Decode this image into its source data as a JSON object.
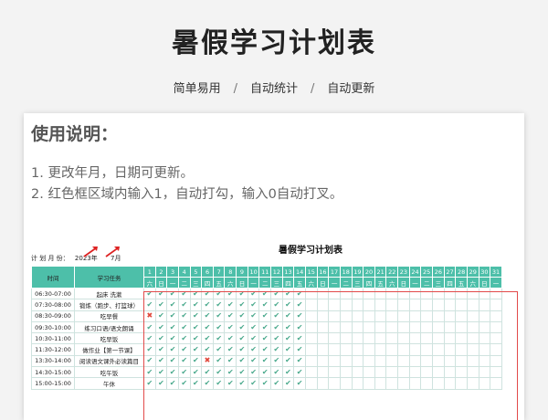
{
  "header": {
    "title": "暑假学习计划表",
    "tags": [
      "简单易用",
      "自动统计",
      "自动更新"
    ],
    "separator": "/"
  },
  "usage": {
    "heading": "使用说明：",
    "lines": [
      "1. 更改年月，日期可更新。",
      "2. 红色框区域内输入1，自动打勾，输入0自动打叉。"
    ]
  },
  "sheet": {
    "title": "暑假学习计划表",
    "plan_label": "计 划 月 份：",
    "year": "2023年",
    "month": "7月",
    "col_time": "时间",
    "col_task": "学习任务",
    "days": [
      "1",
      "2",
      "3",
      "4",
      "5",
      "6",
      "7",
      "8",
      "9",
      "10",
      "11",
      "12",
      "13",
      "14",
      "15",
      "16",
      "17",
      "18",
      "19",
      "20",
      "21",
      "22",
      "23",
      "24",
      "25",
      "26",
      "27",
      "28",
      "29",
      "30",
      "31"
    ],
    "weekdays": [
      "六",
      "日",
      "一",
      "二",
      "三",
      "四",
      "五",
      "六",
      "日",
      "一",
      "二",
      "三",
      "四",
      "五",
      "六",
      "日",
      "一",
      "二",
      "三",
      "四",
      "五",
      "六",
      "日",
      "一",
      "二",
      "三",
      "四",
      "五",
      "六",
      "日",
      "一"
    ],
    "rows": [
      {
        "time": "06:30-07:00",
        "task": "起床 洗漱",
        "marks": "11111111111111"
      },
      {
        "time": "07:30-08:00",
        "task": "锻炼（跑步、打篮球）",
        "marks": "11111111111111"
      },
      {
        "time": "08:30-09:00",
        "task": "吃早餐",
        "marks": "01111111111111"
      },
      {
        "time": "09:30-10:00",
        "task": "练习口语/语文朗诵",
        "marks": "11111111111111"
      },
      {
        "time": "10:30-11:00",
        "task": "吃早饭",
        "marks": "11111111111111"
      },
      {
        "time": "11:30-12:00",
        "task": "做作业【第一节课】",
        "marks": "11111111111111"
      },
      {
        "time": "13:30-14:00",
        "task": "阅读语文课外必读篇目",
        "marks": "11111011111111"
      },
      {
        "time": "14:30-15:00",
        "task": "吃午饭",
        "marks": "11111111111111"
      },
      {
        "time": "15:00-15:00",
        "task": "午休",
        "marks": "11111111111111"
      }
    ],
    "check_symbol": "✔",
    "cross_symbol": "✖"
  },
  "colors": {
    "header_bg": "#4dbfa9",
    "check": "#49a98c",
    "cross": "#e0463a",
    "redbox": "#e24a4a"
  }
}
